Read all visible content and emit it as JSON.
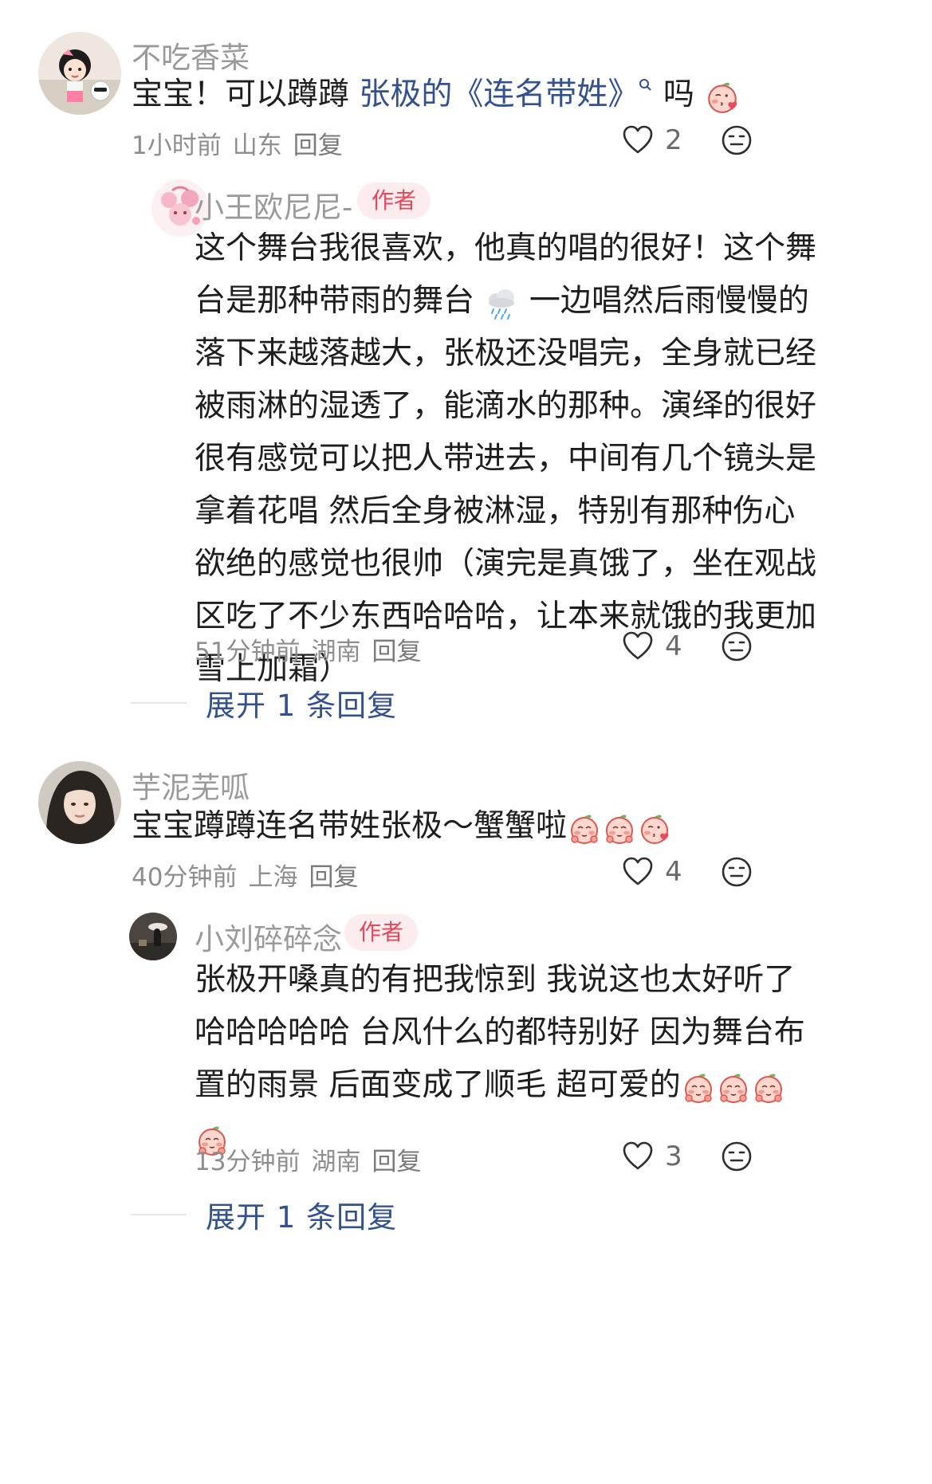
{
  "comments": [
    {
      "username": "不吃香菜",
      "text_prefix": "宝宝！可以蹲蹲 ",
      "text_link": "张极的《连名带姓》",
      "text_suffix": " 吗",
      "time": "1小时前",
      "location": "山东",
      "reply_label": "回复",
      "likes": "2",
      "replies": [
        {
          "username": "小王欧尼尼-",
          "badge": "作者",
          "lines": [
            "这个舞台我很喜欢，他真的唱的很好！这个舞",
            "台是那种带雨的舞台",
            "一边唱然后雨慢慢的",
            "落下来越落越大，张极还没唱完，全身就已经",
            "被雨淋的湿透了，能滴水的那种。演绎的很好",
            "很有感觉可以把人带进去，中间有几个镜头是",
            "拿着花唱 然后全身被淋湿，特别有那种伤心",
            "欲绝的感觉也很帅（演完是真饿了，坐在观战",
            "区吃了不少东西哈哈哈，让本来就饿的我更加",
            "雪上加霜）"
          ],
          "time": "51分钟前",
          "location": "湖南",
          "reply_label": "回复",
          "likes": "4"
        }
      ],
      "expand_label": "展开 1 条回复"
    },
    {
      "username": "芋泥芜呱",
      "text": "宝宝蹲蹲连名带姓张极～蟹蟹啦",
      "time": "40分钟前",
      "location": "上海",
      "reply_label": "回复",
      "likes": "4",
      "replies": [
        {
          "username": "小刘碎碎念",
          "badge": "作者",
          "lines": [
            "张极开嗓真的有把我惊到 我说这也太好听了",
            "哈哈哈哈哈 台风什么的都特别好 因为舞台布",
            "置的雨景 后面变成了顺毛 超可爱的"
          ],
          "time": "13分钟前",
          "location": "湖南",
          "reply_label": "回复",
          "likes": "3"
        }
      ],
      "expand_label": "展开 1 条回复"
    }
  ],
  "colors": {
    "link": "#32518e",
    "badge_bg": "#fdecee",
    "badge_text": "#e3485a",
    "meta": "#8e8e8e",
    "username": "#9a9a9a"
  },
  "icons": [
    "heart-icon",
    "dislike-face-icon",
    "rain-cloud-icon",
    "peach-emoji-icon",
    "search-suffix-icon"
  ]
}
